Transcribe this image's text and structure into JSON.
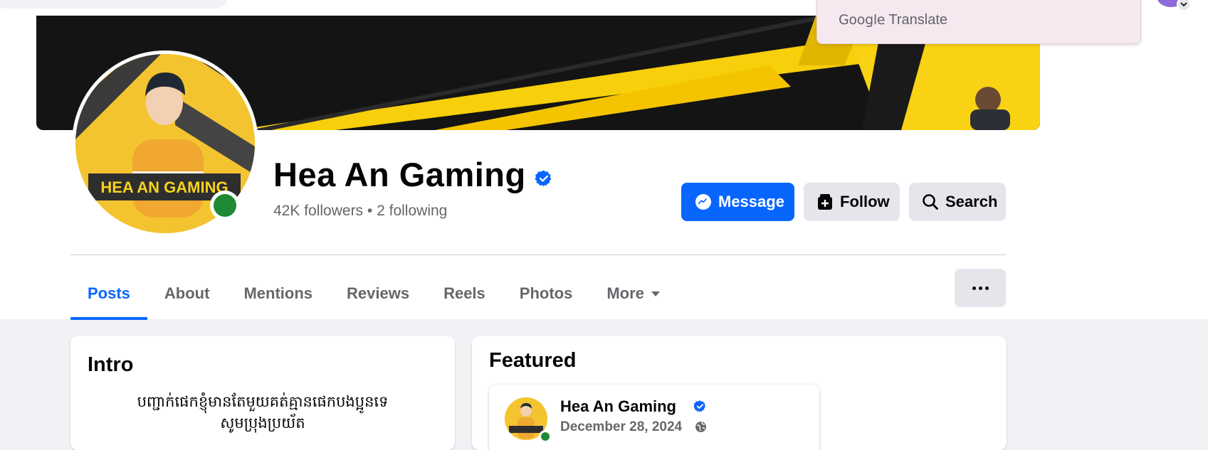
{
  "colors": {
    "accent": "#0866ff",
    "verified": "#0866ff",
    "online": "#1f8a35",
    "cover_yellow": "#f6c800",
    "page_bg": "#f0f2f5",
    "button_gray": "#e4e6eb"
  },
  "translate_popup": {
    "brand": "Google",
    "label": "Translate"
  },
  "profile": {
    "name": "Hea An Gaming",
    "verified_icon": "verified-badge-icon",
    "followers": "42K followers",
    "separator": "•",
    "following": "2 following",
    "avatar_banner_text": "HEA AN GAMING"
  },
  "actions": {
    "message": {
      "label": "Message",
      "icon": "messenger-icon"
    },
    "follow": {
      "label": "Follow",
      "icon": "follow-plus-icon"
    },
    "search": {
      "label": "Search",
      "icon": "search-icon"
    }
  },
  "tabs": [
    {
      "label": "Posts",
      "active": true
    },
    {
      "label": "About",
      "active": false
    },
    {
      "label": "Mentions",
      "active": false
    },
    {
      "label": "Reviews",
      "active": false
    },
    {
      "label": "Reels",
      "active": false
    },
    {
      "label": "Photos",
      "active": false
    },
    {
      "label": "More",
      "active": false
    }
  ],
  "intro": {
    "title": "Intro",
    "bio_line1": "បញ្ជាក់ផេកខ្ញុំមានតែមួយគត់គ្មានផេកបងប្អូនទេ",
    "bio_line2": "សូមប្រុងប្រយ័ត"
  },
  "featured": {
    "title": "Featured",
    "post": {
      "author": "Hea An Gaming",
      "date": "December 28, 2024",
      "privacy_icon": "globe-icon"
    }
  }
}
